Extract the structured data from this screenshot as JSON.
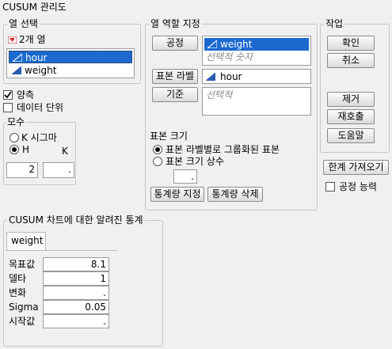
{
  "window": {
    "title": "CUSUM 관리도"
  },
  "column_select": {
    "label": "열 선택",
    "count_label": "2개 열",
    "items": [
      "hour",
      "weight"
    ]
  },
  "options": {
    "two_sided": "양측",
    "data_units": "데이터 단위"
  },
  "parameters": {
    "label": "모수",
    "k_sigma": "K 시그마",
    "h": "H",
    "k": "K",
    "h_value": "2",
    "k_value": "."
  },
  "role": {
    "label": "열 역할 지정",
    "process_button": "공정",
    "process_values": [
      "weight"
    ],
    "process_placeholder": "선택적 숫자",
    "sample_label_button": "표본 라벨",
    "sample_label_value": "hour",
    "by_button": "기준",
    "by_placeholder": "선택적"
  },
  "sample_size": {
    "label": "표본 크기",
    "option_grouped": "표본 라벨별로 그룹화된 표본",
    "option_constant": "표본 크기 상수",
    "value": ".",
    "specify_stats": "통계량 지정",
    "delete_stats": "통계량 삭제"
  },
  "actions": {
    "label": "작업",
    "ok": "확인",
    "cancel": "취소",
    "remove": "제거",
    "recall": "재호출",
    "help": "도움말",
    "get_limits": "한계 가져오기",
    "capability": "공정 능력"
  },
  "known_stats": {
    "label": "CUSUM 차트에 대한 알려진 통계",
    "tab": "weight",
    "rows": [
      {
        "name": "목표값",
        "value": "8.1"
      },
      {
        "name": "델타",
        "value": "1"
      },
      {
        "name": "변화",
        "value": "."
      },
      {
        "name": "Sigma",
        "value": "0.05"
      },
      {
        "name": "시작값",
        "value": "."
      }
    ]
  },
  "colors": {
    "selection": "#1c6ad0",
    "accent_red": "#d12a2a",
    "icon_blue": "#2a5bb0"
  }
}
